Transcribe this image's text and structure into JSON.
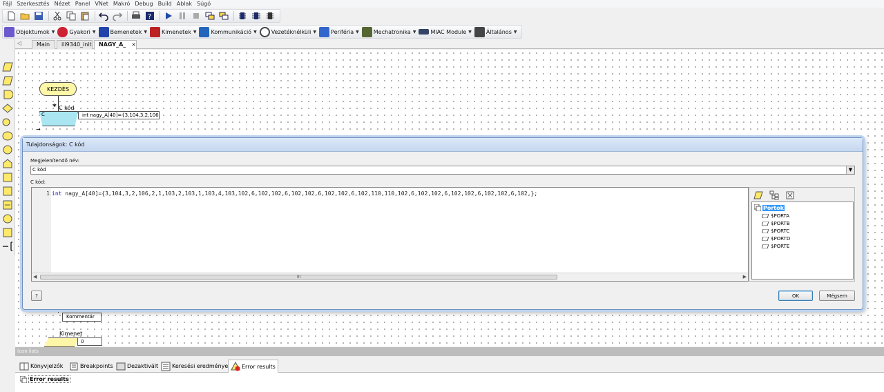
{
  "menubar": {
    "items": [
      "Fájl",
      "Szerkesztés",
      "Nézet",
      "Panel",
      "VNet",
      "Makró",
      "Debug",
      "Build",
      "Ablak",
      "Súgó"
    ]
  },
  "toolbar2": {
    "categories": [
      {
        "label": "Objektumok",
        "icon": "objects-icon",
        "color": "#6a5acd"
      },
      {
        "label": "Gyakori",
        "icon": "common-icon",
        "color": "#cc2233"
      },
      {
        "label": "Bemenetek",
        "icon": "inputs-icon",
        "color": "#2244aa"
      },
      {
        "label": "Kimenetek",
        "icon": "outputs-icon",
        "color": "#bb2222"
      },
      {
        "label": "Kommunikáció",
        "icon": "communication-icon",
        "color": "#2266bb"
      },
      {
        "label": "Vezetéknélküli",
        "icon": "wireless-icon",
        "color": "#444444"
      },
      {
        "label": "Periféria",
        "icon": "peripheral-icon",
        "color": "#3366cc"
      },
      {
        "label": "Mechatronika",
        "icon": "mechatronics-icon",
        "color": "#556633"
      },
      {
        "label": "MIAC Module",
        "icon": "miac-icon",
        "color": "#334466"
      },
      {
        "label": "Általános",
        "icon": "general-icon",
        "color": "#444444"
      }
    ]
  },
  "doc_tabs": {
    "items": [
      {
        "label": "Main",
        "active": false
      },
      {
        "label": "ili9340_init",
        "active": false
      },
      {
        "label": "NAGY_A_",
        "active": true
      }
    ],
    "close": "×"
  },
  "canvas": {
    "start_label": "KEZDÉS",
    "c_block_title": "C kód",
    "c_block_letter": "C",
    "c_callout": "int nagy_A[40]={3,104,3,2,106,...",
    "comment_label": "Kommentár",
    "output_label": "Kimenet",
    "output_value": "0"
  },
  "dialog": {
    "title": "Tulajdonságok: C kód",
    "display_name_label": "Megjelenítendő név:",
    "display_name_value": "C kód",
    "code_label": "C kód:",
    "line_number": "1",
    "code_keyword": "int",
    "code_text": " nagy_A[40]={3,104,3,2,106,2,1,103,2,103,1,103,4,103,102,6,102,102,6,102,102,6,102,102,6,102,110,110,102,6,102,102,6,102,102,6,102,102,6,102,};",
    "ports_root": "Portok",
    "ports": [
      "$PORTA",
      "$PORTB",
      "$PORTC",
      "$PORTD",
      "$PORTE"
    ],
    "help_button": "?",
    "ok_button": "OK",
    "cancel_button": "Mégsem",
    "scroll_grip": "III"
  },
  "bottom_panel": {
    "title": "Icon lists",
    "tabs": [
      {
        "label": "Könyvjelzők",
        "icon": "bookmarks-icon"
      },
      {
        "label": "Breakpoints",
        "icon": "breakpoints-icon"
      },
      {
        "label": "Dezaktivált",
        "icon": "disabled-icon"
      },
      {
        "label": "Keresési eredmények",
        "icon": "search-results-icon"
      },
      {
        "label": "Error results",
        "icon": "error-results-icon",
        "active": true
      }
    ],
    "results_header": "Error results"
  }
}
